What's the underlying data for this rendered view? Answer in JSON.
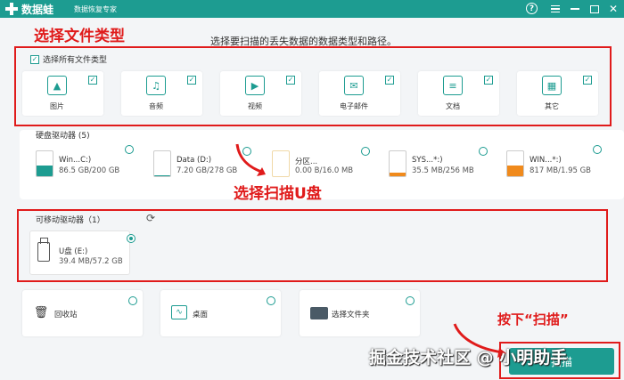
{
  "app": {
    "name": "数据蛙",
    "subtitle": "数据恢复专家"
  },
  "window_controls": {
    "help": "?",
    "close": "✕"
  },
  "annotations": {
    "select_types": "选择文件类型",
    "select_usb": "选择扫描U盘",
    "press_scan": "按下“扫描”"
  },
  "instruction": "选择要扫描的丢失数据的数据类型和路径。",
  "file_types": {
    "select_all_label": "选择所有文件类型",
    "items": [
      {
        "label": "图片",
        "icon": "image-icon"
      },
      {
        "label": "音频",
        "icon": "music-icon"
      },
      {
        "label": "视频",
        "icon": "video-icon"
      },
      {
        "label": "电子邮件",
        "icon": "email-icon"
      },
      {
        "label": "文档",
        "icon": "document-icon"
      },
      {
        "label": "其它",
        "icon": "other-icon"
      }
    ]
  },
  "hard_drives": {
    "title": "硬盘驱动器 (5)",
    "items": [
      {
        "name": "Win...C:)",
        "size": "86.5 GB/200 GB",
        "fill": 0.43,
        "color": "#1d9c91"
      },
      {
        "name": "Data (D:)",
        "size": "7.20 GB/278 GB",
        "fill": 0.03,
        "color": "#1d9c91"
      },
      {
        "name": "分区...",
        "size": "0.00  B/16.0 MB",
        "fill": 0.0,
        "color": "#1d9c91"
      },
      {
        "name": "SYS...*:)",
        "size": "35.5 MB/256 MB",
        "fill": 0.14,
        "color": "#f08a1c"
      },
      {
        "name": "WIN...*:)",
        "size": "817 MB/1.95 GB",
        "fill": 0.42,
        "color": "#f08a1c"
      }
    ]
  },
  "removable": {
    "title": "可移动驱动器（1）",
    "refresh_icon": "refresh-icon",
    "items": [
      {
        "name": "U盘 (E:)",
        "size": "39.4 MB/57.2 GB",
        "selected": true
      }
    ]
  },
  "locations": [
    {
      "label": "回收站",
      "icon": "trash-icon"
    },
    {
      "label": "桌面",
      "icon": "desktop-icon"
    },
    {
      "label": "选择文件夹",
      "icon": "folder-icon"
    }
  ],
  "scan_button": "扫描",
  "watermark": "掘金技术社区 @ 小明助手",
  "colors": {
    "accent": "#1d9c91",
    "annotation": "#e01b1b",
    "warn": "#f08a1c"
  }
}
